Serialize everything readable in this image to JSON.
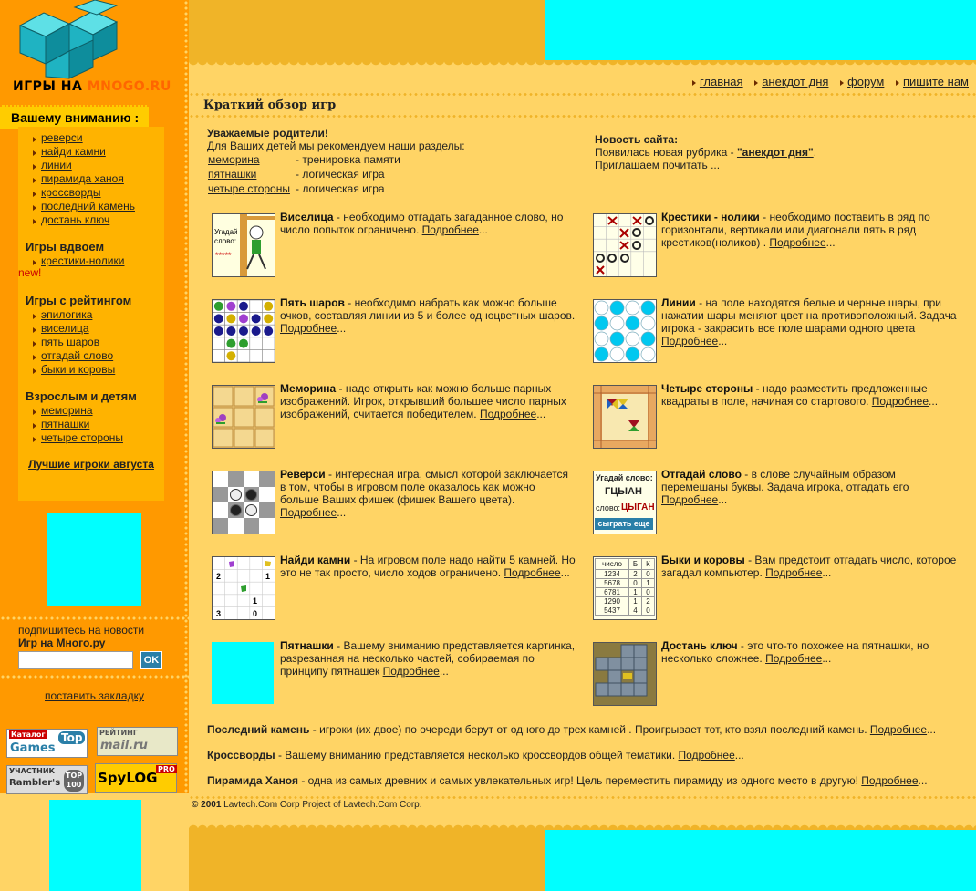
{
  "logo": {
    "part1": "ИГРЫ НА ",
    "part2": "MNOGO.RU"
  },
  "sidebar": {
    "attention": "Вашему вниманию :",
    "group1": [
      "реверси",
      "найди камни",
      "линии",
      "пирамида ханоя",
      "кроссворды",
      "последний камень",
      "достань ключ"
    ],
    "group2_title": "Игры вдвоем",
    "group2": [
      "крестики-нолики"
    ],
    "new_tag": "new!",
    "group3_title": "Игры с рейтингом",
    "group3": [
      "эпилогика",
      "виселица",
      "пять шаров",
      "отгадай слово",
      "быки и коровы"
    ],
    "group4_title": "Взрослым и детям",
    "group4": [
      "меморина",
      "пятнашки",
      "четыре стороны"
    ],
    "best": "Лучшие игроки августа",
    "subscribe_text": "подпишитесь на новости",
    "subscribe_title": "Игр на Много.ру",
    "ok": "OK",
    "bookmark": "поставить закладку",
    "badges": {
      "top_games_1": "Каталог",
      "top_games_2": "Games",
      "top_games_3": "Top",
      "mail_1": "РЕЙТИНГ",
      "mail_2": "mail.ru",
      "rambler_1": "УЧАСТНИК",
      "rambler_2": "Rambler's",
      "rambler_3": "TOP 100",
      "spylog": "SpyLOG",
      "spylog_pro": "PRO"
    }
  },
  "nav": [
    "главная",
    "анекдот дня",
    "форум",
    "пишите нам"
  ],
  "overview_title": "Краткий обзор игр",
  "parents": {
    "title": "Уважаемые родители!",
    "intro": "Для Ваших детей мы рекомендуем наши разделы:",
    "rows": [
      {
        "name": "меморина",
        "desc": "- тренировка памяти"
      },
      {
        "name": "пятнашки",
        "desc": "- логическая игра"
      },
      {
        "name": "четыре стороны",
        "desc": "- логическая игра"
      }
    ]
  },
  "news": {
    "title": "Новость сайта:",
    "line1": "Появилась новая рубрика - ",
    "link": "\"анекдот дня\"",
    "line1_end": ".",
    "line2": "Приглашаем почитать ..."
  },
  "more": "Подробнее",
  "games": [
    {
      "name": "Виселица",
      "desc": " - необходимо отгадать загаданное слово, но число попыток ограничено. "
    },
    {
      "name": "Крестики - нолики",
      "desc": " - необходимо поставить в ряд по горизонтали, вертикали или диагонали пять в ряд крестиков(ноликов) . "
    },
    {
      "name": "Пять шаров",
      "desc": " - необходимо набрать как можно больше очков, составляя линии из 5 и более одноцветных шаров. "
    },
    {
      "name": "Линии",
      "desc": " - на поле находятся белые и черные шары, при нажатии шары меняют цвет на противоположный. Задача игрока - закрасить все поле шарами одного цвета "
    },
    {
      "name": "Меморина",
      "desc": " - надо открыть как можно больше парных изображений. Игрок, открывший большее число парных изображений, считается победителем. "
    },
    {
      "name": "Четыре стороны",
      "desc": " - надо разместить предложенные квадраты в поле, начиная со стартового. "
    },
    {
      "name": "Реверси",
      "desc": " - интересная игра, смысл которой заключается в том, чтобы в игровом поле оказалось как можно больше Ваших фишек (фишек Вашего цвета). "
    },
    {
      "name": "Отгадай слово",
      "desc": " - в слове случайным образом перемешаны буквы. Задача игрока, отгадать его "
    },
    {
      "name": "Найди камни",
      "desc": " - На игровом поле надо найти 5 камней. Но это не так просто, число ходов ограничено. "
    },
    {
      "name": "Быки и коровы",
      "desc": " - Вам предстоит отгадать число, которое загадал компьютер. "
    },
    {
      "name": "Пятнашки",
      "desc": " - Вашему вниманию представляется картинка, разрезанная на несколько частей, собираемая по принципу пятнашек "
    },
    {
      "name": "Достань ключ",
      "desc": " - это что-то похожее на пятнашки, но несколько сложнее. "
    }
  ],
  "thumbs": {
    "hangman_1": "Угадай",
    "hangman_2": "слово:",
    "hangman_3": "*****",
    "word_1": "Угадай слово:",
    "word_2": "ГЦЫАН",
    "word_3": "слово:",
    "word_4": "ЦЫГАН",
    "word_5": "сыграть еще",
    "bulls_h1": "число",
    "bulls_h2": "Б",
    "bulls_h3": "К",
    "bulls_rows": [
      [
        "1234",
        "2",
        "0"
      ],
      [
        "5678",
        "0",
        "1"
      ],
      [
        "6781",
        "1",
        "0"
      ],
      [
        "1290",
        "1",
        "2"
      ],
      [
        "5437",
        "4",
        "0"
      ]
    ],
    "stones": [
      "2",
      "1",
      "1",
      "3",
      "0"
    ]
  },
  "full_rows": [
    {
      "name": "Последний камень",
      "desc": " - игроки (их двое) по очереди берут от одного до трех камней . Проигрывает тот, кто взял последний камень. "
    },
    {
      "name": "Кроссворды",
      "desc": " - Вашему вниманию представляется несколько кроссвордов общей тематики. "
    },
    {
      "name": "Пирамида Ханоя",
      "desc": " - одна из самых древних и самых увлекательных игр! Цель переместить пирамиду из одного место в другую! "
    }
  ],
  "copyright": {
    "sym": "© 2001",
    "text": " Lavtech.Com Corp Project of Lavtech.Com Corp."
  },
  "colors": {
    "left": "#FF9900",
    "bg": "#FFD465",
    "accent": "#F0B428",
    "cyan": "#00FFFF"
  }
}
